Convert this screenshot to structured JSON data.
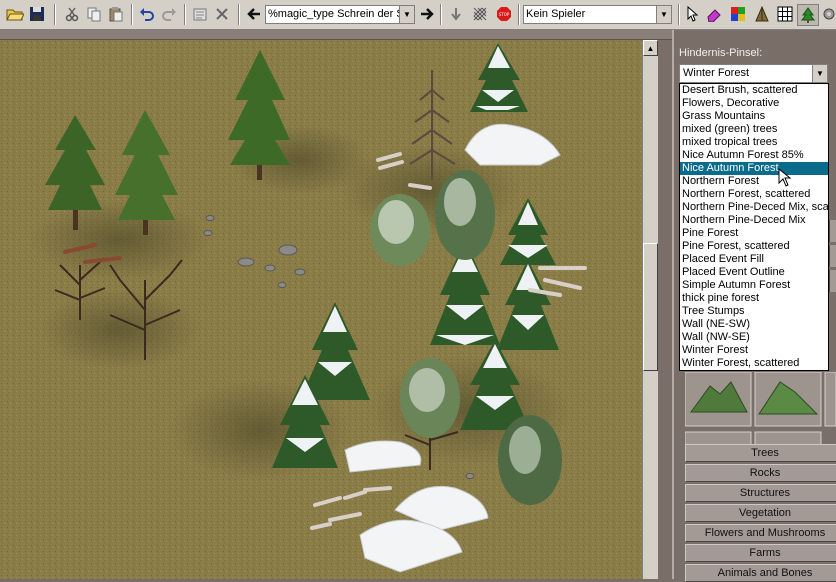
{
  "toolbar": {
    "icons": [
      "open-folder-icon",
      "save-icon",
      "cut-icon",
      "copy-icon",
      "paste-icon",
      "undo-icon",
      "redo-icon",
      "properties-icon",
      "delete-icon",
      "arrow-left-icon",
      "arrow-right-icon",
      "lower-terrain-icon",
      "pattern-icon",
      "stop-icon",
      "pointer-icon",
      "eraser-icon",
      "palette-icon",
      "ground-icon",
      "grid-icon",
      "tree-brush-icon",
      "settings-icon"
    ],
    "script_value": "%magic_type Schrein der St",
    "player_value": "Kein Spieler"
  },
  "panel": {
    "label": "Hindernis-Pinsel:",
    "selected_brush": "Winter Forest",
    "options": [
      "Desert Brush, scattered",
      "Flowers, Decorative",
      "Grass Mountains",
      "mixed (green) trees",
      "mixed tropical trees",
      "Nice Autumn Forest 85%",
      "Nice Autumn Forest",
      "Northern Forest",
      "Northern Forest, scattered",
      "Northern Pine-Deced Mix, scat",
      "Northern Pine-Deced Mix",
      "Pine Forest",
      "Pine Forest, scattered",
      "Placed Event Fill",
      "Placed Event Outline",
      "Simple Autumn Forest",
      "thick pine forest",
      "Tree Stumps",
      "Wall (NE-SW)",
      "Wall (NW-SE)",
      "Winter Forest",
      "Winter Forest, scattered"
    ],
    "highlighted_index": 6,
    "categories": [
      "Trees",
      "Rocks",
      "Structures",
      "Vegetation",
      "Flowers and Mushrooms",
      "Farms",
      "Animals and Bones"
    ]
  },
  "colors": {
    "grass": "#8a7d48",
    "highlight": "#0a6b8a",
    "panel_bg": "#7a6e68",
    "button_face": "#a39a96"
  }
}
